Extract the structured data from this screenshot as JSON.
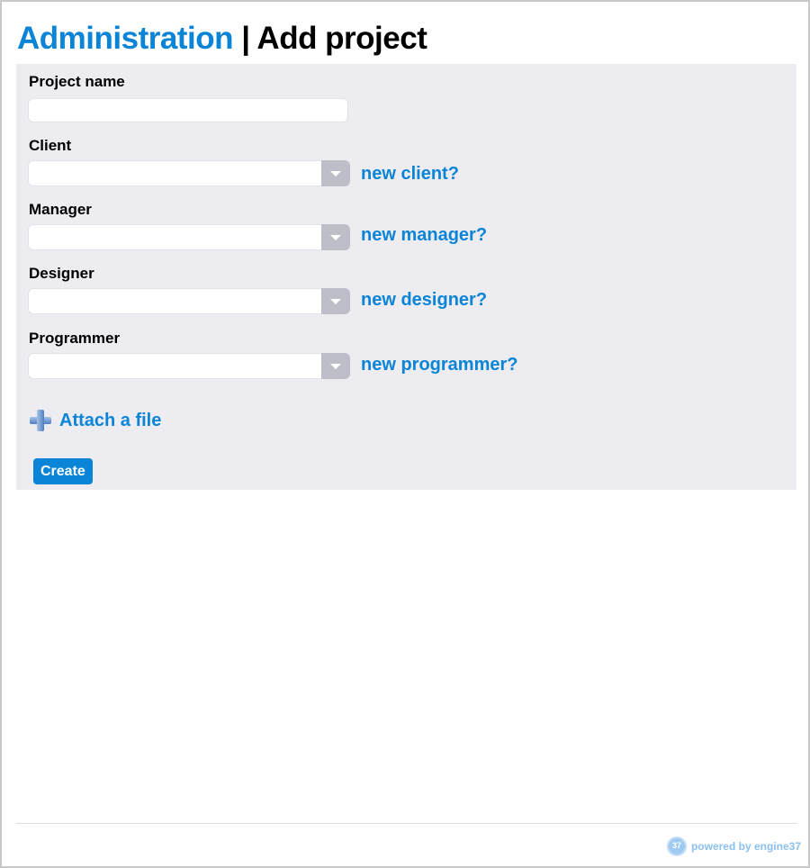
{
  "header": {
    "section_link": "Administration",
    "separator": "|",
    "page_title": "Add project"
  },
  "form": {
    "project_name": {
      "label": "Project name",
      "value": "",
      "placeholder": ""
    },
    "client": {
      "label": "Client",
      "selected": "",
      "new_link": "new client?"
    },
    "manager": {
      "label": "Manager",
      "selected": "",
      "new_link": "new manager?"
    },
    "designer": {
      "label": "Designer",
      "selected": "",
      "new_link": "new designer?"
    },
    "programmer": {
      "label": "Programmer",
      "selected": "",
      "new_link": "new programmer?"
    },
    "attach_label": "Attach a file",
    "attach_icon": "plus-icon",
    "submit_label": "Create"
  },
  "footer": {
    "powered_by": "powered by engine37",
    "logo_text": "37",
    "logo_icon": "gear-icon"
  },
  "colors": {
    "accent": "#0a84d6",
    "panel_background": "#ececf1",
    "select_button": "#bebec8",
    "footer_text": "#8cc0ee"
  }
}
